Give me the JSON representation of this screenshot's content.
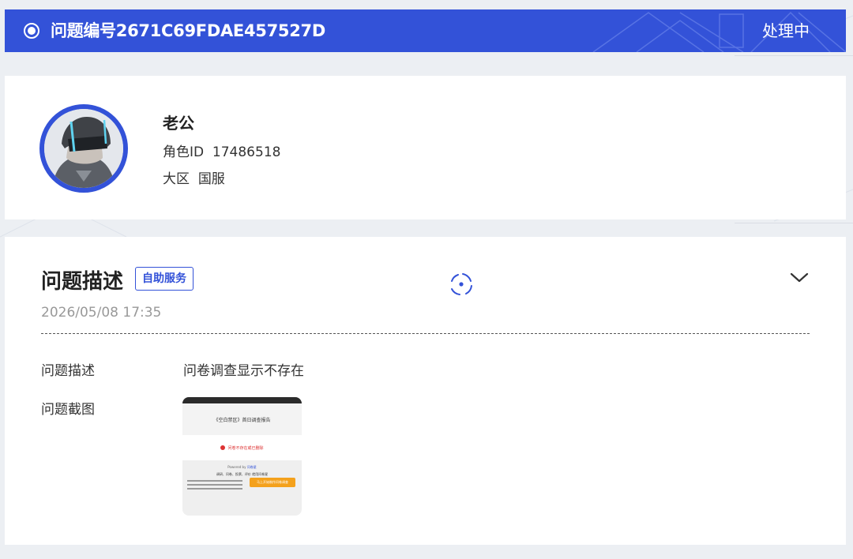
{
  "header": {
    "status_icon": "radio-dot-icon",
    "title": "问题编号2671C69FDAE457527D",
    "status": "处理中"
  },
  "profile": {
    "avatar_icon": "user-avatar",
    "name": "老公",
    "role_label": "角色ID",
    "role_id": "17486518",
    "region_label": "大区",
    "region": "国服"
  },
  "issue": {
    "title": "问题描述",
    "tag": "自助服务",
    "loading_icon": "spinner-icon",
    "expand_icon": "chevron-down-icon",
    "date": "2026/05/08 17:35",
    "description_label": "问题描述",
    "description": "问卷调查显示不存在",
    "screenshot_label": "问题截图",
    "screenshot": {
      "heading": "《空白禁区》首日调查报告",
      "error": "问卷不存在或已删除",
      "powered_by": "Powered by",
      "powered_link": "问卷星",
      "footer": "调研、问卷、投票、评价 就用问卷星",
      "button": "马上开始制作问卷调查"
    }
  },
  "colors": {
    "accent": "#3352d8",
    "header_text": "#ffffff",
    "date_text": "#999999",
    "thumb_button": "#f4a11c"
  }
}
